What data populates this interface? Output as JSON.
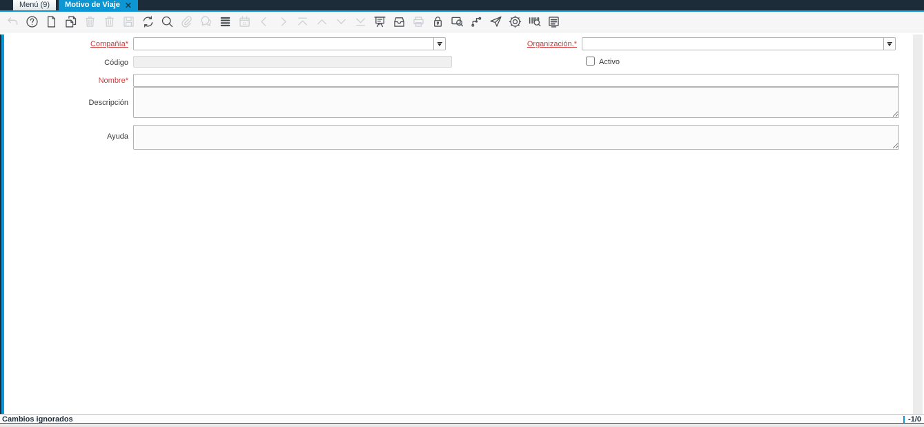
{
  "colors": {
    "header_navy": "#1d2c39",
    "accent_blue": "#0d96d4",
    "required_red": "#cf3a3a",
    "toolbar_icon": "#4b4f54",
    "toolbar_icon_disabled": "#ccd0d4"
  },
  "tabbar": {
    "tabs": [
      {
        "label": "Menú (9)",
        "active": false
      },
      {
        "label": "Motivo de Viaje",
        "active": true,
        "close_icon": "✕"
      }
    ]
  },
  "toolbar": {
    "icons": [
      {
        "name": "undo",
        "glyph": "undo-arrow",
        "enabled": false
      },
      {
        "name": "help",
        "glyph": "question-circle",
        "enabled": true
      },
      {
        "name": "new-record",
        "glyph": "new-document",
        "enabled": true
      },
      {
        "name": "copy-record",
        "glyph": "copy-documents",
        "enabled": true
      },
      {
        "name": "delete-record",
        "glyph": "trash",
        "enabled": false
      },
      {
        "name": "delete-selection",
        "glyph": "trash",
        "enabled": false
      },
      {
        "name": "save",
        "glyph": "floppy-disk",
        "enabled": false
      },
      {
        "name": "refresh",
        "glyph": "refresh-arrows",
        "enabled": true
      },
      {
        "name": "find",
        "glyph": "magnifier",
        "enabled": true
      },
      {
        "name": "attachment",
        "glyph": "paperclip",
        "enabled": false
      },
      {
        "name": "chat",
        "glyph": "speech-bubbles",
        "enabled": false
      },
      {
        "name": "grid-toggle",
        "glyph": "stacked-rows",
        "enabled": true
      },
      {
        "name": "calendar",
        "glyph": "calendar-31",
        "enabled": false
      },
      {
        "name": "parent-record",
        "glyph": "chevron-left",
        "enabled": false
      },
      {
        "name": "detail-record",
        "glyph": "chevron-right",
        "enabled": false
      },
      {
        "name": "first-record",
        "glyph": "arrow-to-top",
        "enabled": false
      },
      {
        "name": "previous-record",
        "glyph": "chevron-up",
        "enabled": false
      },
      {
        "name": "next-record",
        "glyph": "chevron-down",
        "enabled": false
      },
      {
        "name": "last-record",
        "glyph": "arrow-to-bottom",
        "enabled": false
      },
      {
        "name": "report",
        "glyph": "presentation-board",
        "enabled": true
      },
      {
        "name": "archive",
        "glyph": "archive-drawer",
        "enabled": true
      },
      {
        "name": "print",
        "glyph": "printer",
        "enabled": false
      },
      {
        "name": "lock",
        "glyph": "padlock",
        "enabled": true
      },
      {
        "name": "zoom-across",
        "glyph": "window-magnifier",
        "enabled": true
      },
      {
        "name": "workflow",
        "glyph": "workflow-nodes",
        "enabled": true
      },
      {
        "name": "send",
        "glyph": "paper-plane",
        "enabled": true
      },
      {
        "name": "preferences",
        "glyph": "gear",
        "enabled": true
      },
      {
        "name": "product-info",
        "glyph": "barcode-magnifier",
        "enabled": true
      },
      {
        "name": "log",
        "glyph": "document-lines",
        "enabled": true
      }
    ]
  },
  "form": {
    "compania": {
      "label": "Compañía*",
      "value": "",
      "required": true
    },
    "organizacion": {
      "label": "Organización.*",
      "value": "",
      "required": true
    },
    "codigo": {
      "label": "Código",
      "value": "",
      "disabled": true
    },
    "activo": {
      "label": "Activo",
      "checked": false
    },
    "nombre": {
      "label": "Nombre*",
      "value": "",
      "required": true
    },
    "descripcion": {
      "label": "Descripción",
      "value": ""
    },
    "ayuda": {
      "label": "Ayuda",
      "value": ""
    }
  },
  "statusbar": {
    "message": "Cambios ignorados",
    "record_indicator": "-1/0"
  }
}
